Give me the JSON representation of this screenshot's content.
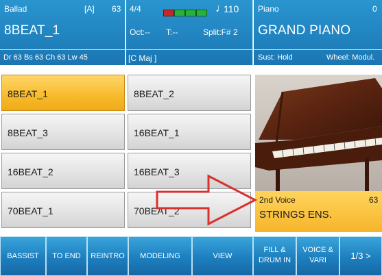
{
  "style_panel": {
    "category": "Ballad",
    "mode": "[A]",
    "value": "63",
    "name": "8BEAT_1",
    "mix_info": "Dr 63  Bs 63  Ch 63  Lw 45"
  },
  "mid_panel": {
    "time_sig": "4/4",
    "tempo": "110",
    "octave": "Oct:--",
    "transpose": "T:--",
    "split": "Split:F# 2",
    "chord": "[C Maj         ]"
  },
  "voice_panel": {
    "label": "Piano",
    "value": "0",
    "name": "GRAND PIANO",
    "sustain": "Sust: Hold",
    "wheel": "Wheel: Modul."
  },
  "styles": [
    "8BEAT_1",
    "8BEAT_2",
    "8BEAT_3",
    "16BEAT_1",
    "16BEAT_2",
    "16BEAT_3",
    "70BEAT_1",
    "70BEAT_2"
  ],
  "second_voice": {
    "label": "2nd Voice",
    "value": "63",
    "name": "STRINGS ENS."
  },
  "buttons": {
    "bassist": "BASSIST",
    "to_end": "TO END",
    "reintro": "REINTRO",
    "modeling": "MODELING",
    "view": "VIEW",
    "fill_line1": "FILL &",
    "fill_line2": "DRUM IN",
    "voice_line1": "VOICE &",
    "voice_line2": "VARI",
    "page": "1/3 >"
  },
  "colors": {
    "panel_blue": "#1a76b3",
    "selected_amber": "#f7bb2a",
    "arrow_red": "#d8312e",
    "meter_green": "#27b13c"
  }
}
